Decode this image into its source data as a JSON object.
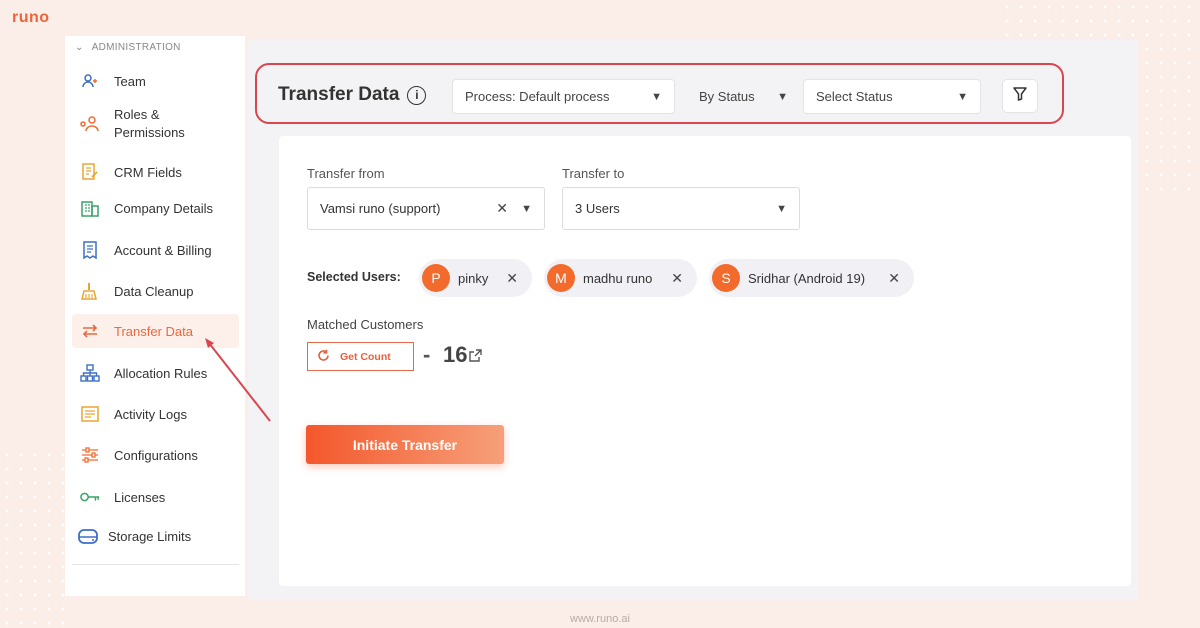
{
  "brand": {
    "logo": "runo",
    "footer_url": "www.runo.ai"
  },
  "sidebar": {
    "section": "ADMINISTRATION",
    "items": [
      {
        "label": "Team",
        "icon": "users-icon"
      },
      {
        "label": "Roles &\nPermissions",
        "icon": "roles-icon"
      },
      {
        "label": "CRM Fields",
        "icon": "form-edit-icon"
      },
      {
        "label": "Company Details",
        "icon": "building-icon"
      },
      {
        "label": "Account & Billing",
        "icon": "receipt-icon"
      },
      {
        "label": "Data Cleanup",
        "icon": "broom-icon"
      },
      {
        "label": "Transfer Data",
        "icon": "transfer-arrows-icon",
        "active": true
      },
      {
        "label": "Allocation Rules",
        "icon": "hierarchy-icon"
      },
      {
        "label": "Activity Logs",
        "icon": "log-icon"
      },
      {
        "label": "Configurations",
        "icon": "sliders-icon"
      },
      {
        "label": "Licenses",
        "icon": "key-icon"
      },
      {
        "label": "Storage Limits",
        "icon": "storage-icon"
      }
    ]
  },
  "header": {
    "title": "Transfer Data",
    "process_select": "Process: Default process",
    "mode_select": "By Status",
    "status_select": "Select Status"
  },
  "form": {
    "from_label": "Transfer from",
    "from_value": "Vamsi runo (support)",
    "to_label": "Transfer to",
    "to_value": "3 Users",
    "selected_label": "Selected Users:",
    "users": [
      {
        "initial": "P",
        "name": "pinky"
      },
      {
        "initial": "M",
        "name": "madhu runo"
      },
      {
        "initial": "S",
        "name": "Sridhar (Android 19)"
      }
    ],
    "matched_label": "Matched Customers",
    "get_count": "Get Count",
    "count_dash": "-",
    "count": "16",
    "initiate": "Initiate Transfer"
  },
  "colors": {
    "accent": "#f26a2c",
    "highlight_border": "#d9464f"
  }
}
